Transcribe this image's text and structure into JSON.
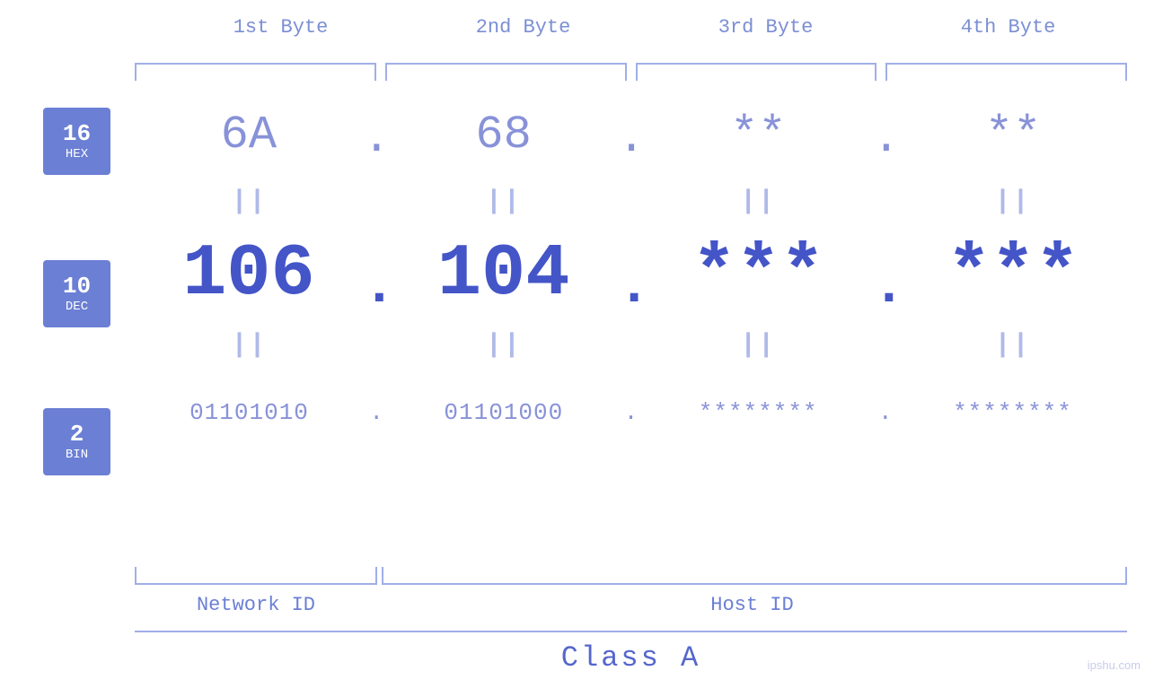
{
  "headers": {
    "byte1": "1st Byte",
    "byte2": "2nd Byte",
    "byte3": "3rd Byte",
    "byte4": "4th Byte"
  },
  "badges": {
    "hex": {
      "number": "16",
      "label": "HEX"
    },
    "dec": {
      "number": "10",
      "label": "DEC"
    },
    "bin": {
      "number": "2",
      "label": "BIN"
    }
  },
  "rows": {
    "hex": {
      "b1": "6A",
      "b2": "68",
      "b3": "**",
      "b4": "**",
      "dot": "."
    },
    "dec": {
      "b1": "106",
      "b2": "104",
      "b3": "***",
      "b4": "***",
      "dot": "."
    },
    "bin": {
      "b1": "01101010",
      "b2": "01101000",
      "b3": "********",
      "b4": "********",
      "dot": "."
    }
  },
  "labels": {
    "network_id": "Network ID",
    "host_id": "Host ID",
    "class": "Class A"
  },
  "watermark": "ipshu.com"
}
